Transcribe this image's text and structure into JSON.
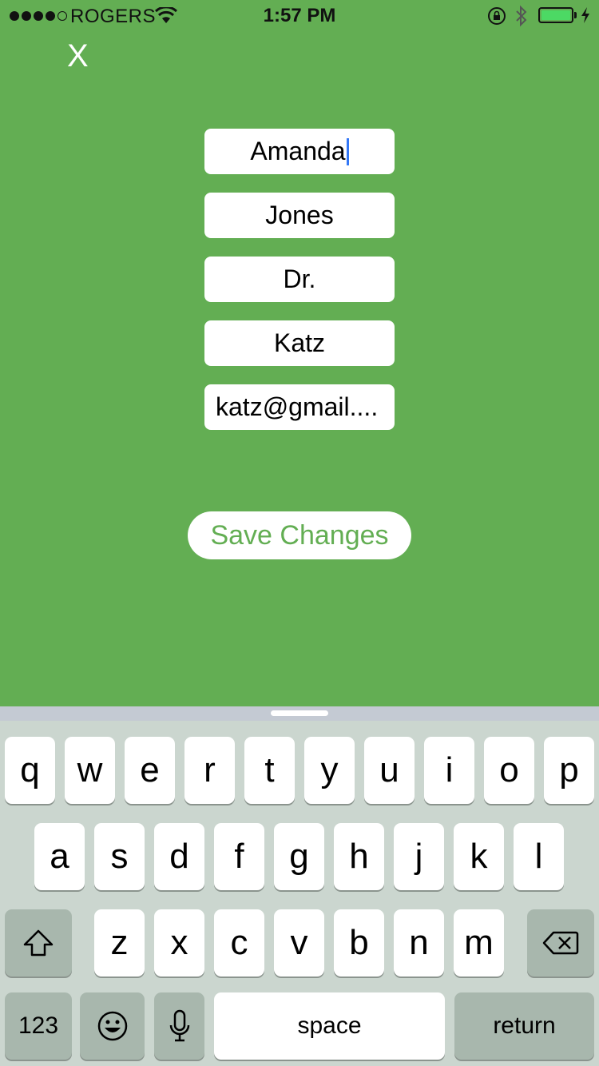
{
  "status_bar": {
    "carrier": "ROGERS",
    "time": "1:57 PM",
    "signal_bars_filled": 4,
    "signal_bars_total": 5,
    "battery_level": 1.0,
    "battery_color": "#4cd964"
  },
  "close_label": "X",
  "fields": {
    "first_name": "Amanda",
    "last_name": "Jones",
    "title": "Dr.",
    "doctor_name": "Katz",
    "email": "katz@gmail...."
  },
  "save_button_label": "Save Changes",
  "colors": {
    "background": "#63ae53",
    "accent": "#63ae53",
    "caret": "#3478f6"
  },
  "keyboard": {
    "row1": [
      "q",
      "w",
      "e",
      "r",
      "t",
      "y",
      "u",
      "i",
      "o",
      "p"
    ],
    "row2": [
      "a",
      "s",
      "d",
      "f",
      "g",
      "h",
      "j",
      "k",
      "l"
    ],
    "row3": [
      "z",
      "x",
      "c",
      "v",
      "b",
      "n",
      "m"
    ],
    "numbers_label": "123",
    "space_label": "space",
    "return_label": "return",
    "icons": [
      "shift-icon",
      "delete-icon",
      "emoji-icon",
      "microphone-icon"
    ]
  }
}
